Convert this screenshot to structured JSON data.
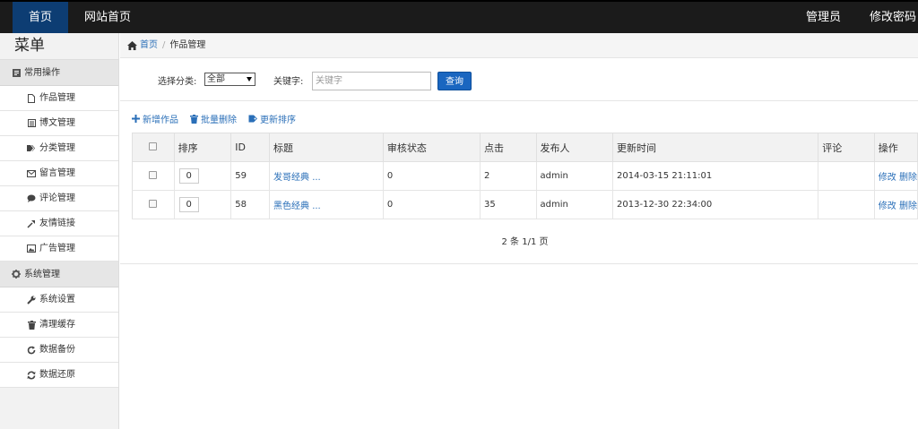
{
  "nav": {
    "home": "首页",
    "site_home": "网站首页",
    "admin": "管理员",
    "change_password": "修改密码"
  },
  "sidebar": {
    "title": "菜单",
    "groups": [
      {
        "label": "常用操作",
        "items": [
          {
            "label": "作品管理"
          },
          {
            "label": "博文管理"
          },
          {
            "label": "分类管理"
          },
          {
            "label": "留言管理"
          },
          {
            "label": "评论管理"
          },
          {
            "label": "友情链接"
          },
          {
            "label": "广告管理"
          }
        ]
      },
      {
        "label": "系统管理",
        "items": [
          {
            "label": "系统设置"
          },
          {
            "label": "清理缓存"
          },
          {
            "label": "数据备份"
          },
          {
            "label": "数据还原"
          }
        ]
      }
    ]
  },
  "breadcrumb": {
    "home": "首页",
    "current": "作品管理"
  },
  "filter": {
    "category_label": "选择分类:",
    "category_value": "全部",
    "keyword_label": "关键字:",
    "keyword_placeholder": "关键字",
    "query_button": "查询"
  },
  "actions": {
    "add": "新增作品",
    "batch_delete": "批量删除",
    "update_order": "更新排序"
  },
  "table": {
    "headers": [
      "排序",
      "ID",
      "标题",
      "审核状态",
      "点击",
      "发布人",
      "更新时间",
      "评论",
      "操作"
    ],
    "rows": [
      {
        "order": "0",
        "id": "59",
        "title": "发哥经典 ...",
        "status": "0",
        "clicks": "2",
        "publisher": "admin",
        "updated": "2014-03-15 21:11:01",
        "comments": "",
        "edit": "修改",
        "delete": "删除"
      },
      {
        "order": "0",
        "id": "58",
        "title": "黑色经典 ...",
        "status": "0",
        "clicks": "35",
        "publisher": "admin",
        "updated": "2013-12-30 22:34:00",
        "comments": "",
        "edit": "修改",
        "delete": "删除"
      }
    ]
  },
  "pager": "2 条 1/1 页",
  "colors": {
    "topbar": "#1b1b1b",
    "active_nav": "#0d3d73",
    "link": "#2a6fb8",
    "button": "#1a66c0"
  }
}
